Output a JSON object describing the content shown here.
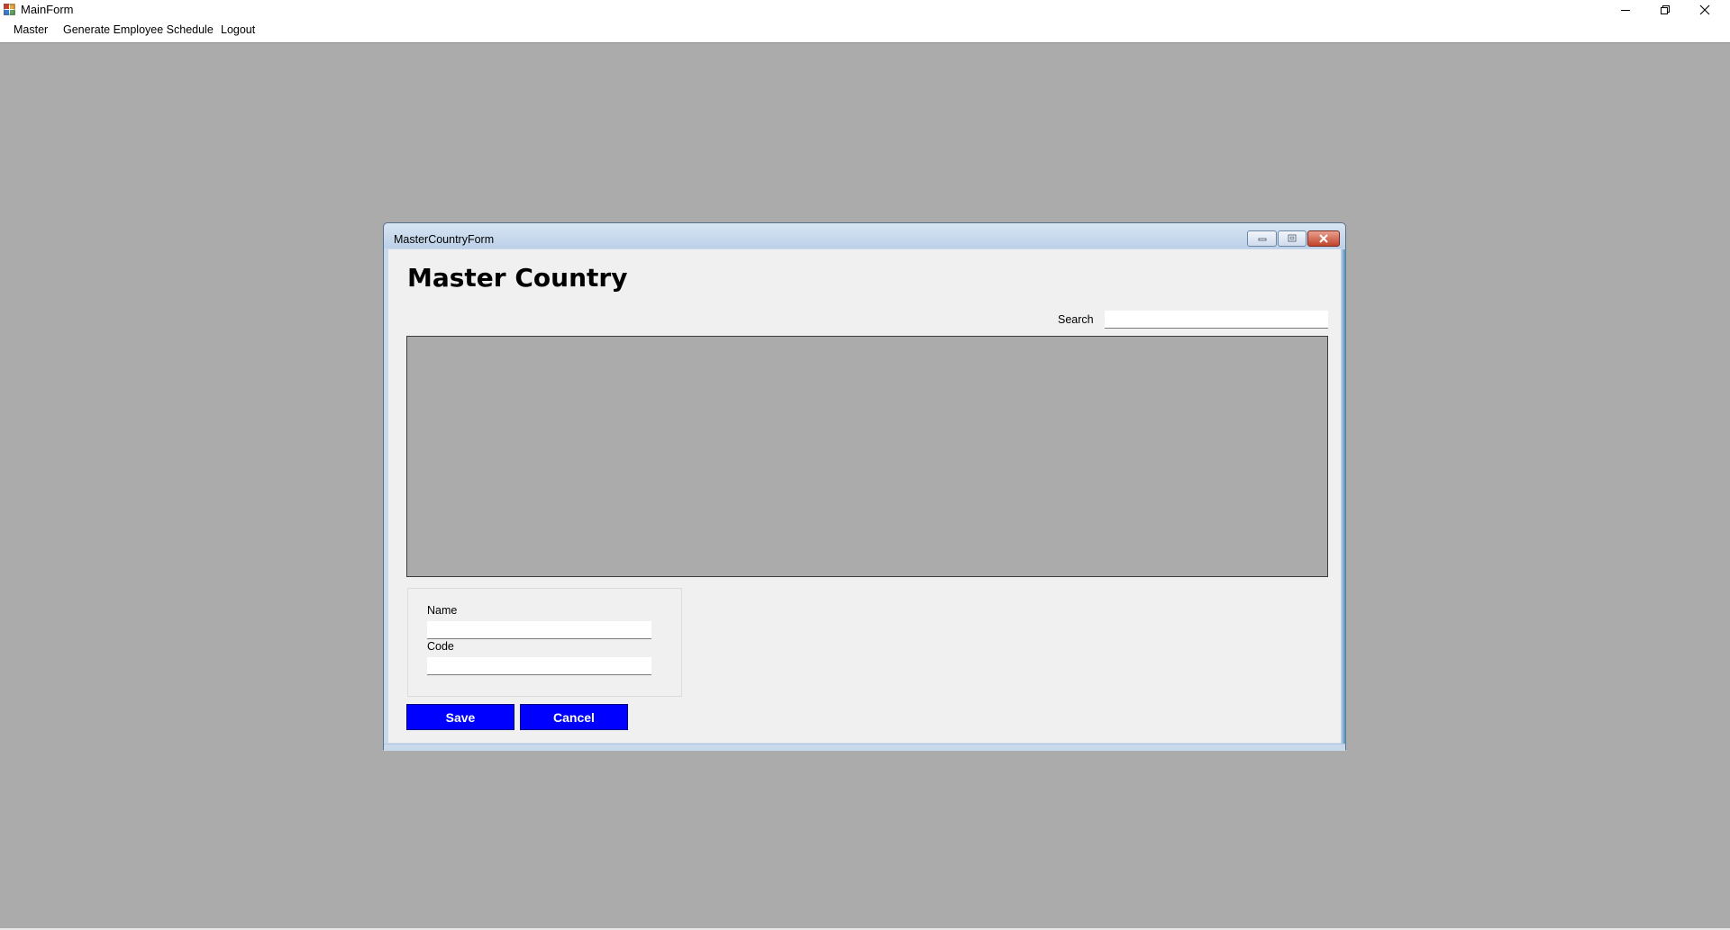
{
  "window": {
    "title": "MainForm"
  },
  "menu": {
    "items": [
      {
        "label": "Master"
      },
      {
        "label": "Generate Employee Schedule"
      },
      {
        "label": "Logout"
      }
    ]
  },
  "child_form": {
    "title": "MasterCountryForm",
    "heading": "Master Country",
    "search": {
      "label": "Search",
      "value": "",
      "placeholder": ""
    },
    "fields": {
      "name": {
        "label": "Name",
        "value": ""
      },
      "code": {
        "label": "Code",
        "value": ""
      }
    },
    "buttons": {
      "save": "Save",
      "cancel": "Cancel"
    }
  },
  "colors": {
    "mdi_background": "#ababab",
    "button_background": "#0000ff",
    "button_text": "#ffffff",
    "form_background": "#f0f0f0"
  },
  "icons": [
    "app-icon",
    "minimize-icon",
    "maximize-icon",
    "close-icon"
  ]
}
